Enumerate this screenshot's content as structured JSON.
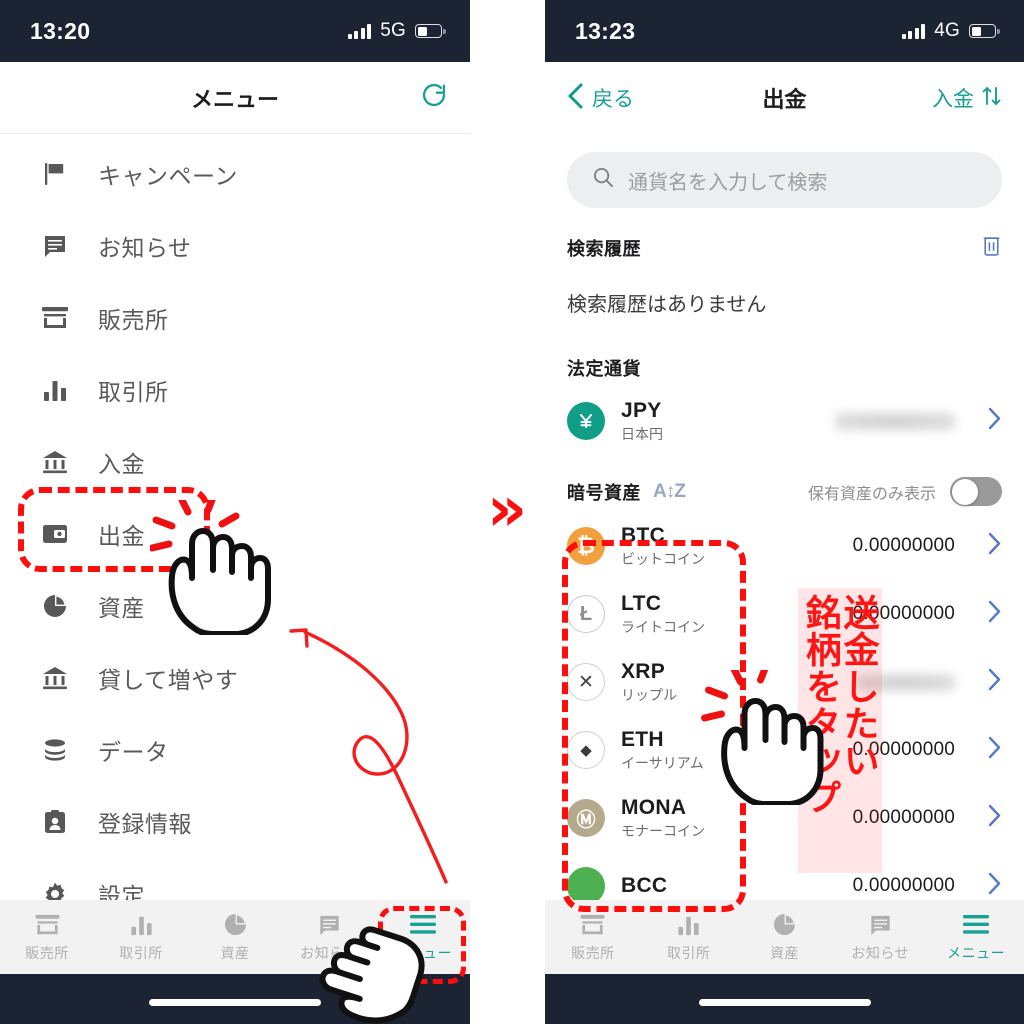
{
  "left_phone": {
    "status_bar": {
      "time": "13:20",
      "network": "5G",
      "signal_icon": "signal-bars-icon",
      "battery_icon": "battery-icon"
    },
    "navbar": {
      "title": "メニュー",
      "refresh_icon": "refresh-icon"
    },
    "menu_items": [
      {
        "label": "キャンペーン",
        "icon": "flag-icon"
      },
      {
        "label": "お知らせ",
        "icon": "message-icon"
      },
      {
        "label": "販売所",
        "icon": "store-icon"
      },
      {
        "label": "取引所",
        "icon": "bar-chart-icon"
      },
      {
        "label": "入金",
        "icon": "bank-icon"
      },
      {
        "label": "出金",
        "icon": "wallet-icon"
      },
      {
        "label": "資産",
        "icon": "pie-chart-icon"
      },
      {
        "label": "貸して増やす",
        "icon": "bank-icon"
      },
      {
        "label": "データ",
        "icon": "database-icon"
      },
      {
        "label": "登録情報",
        "icon": "id-card-icon"
      },
      {
        "label": "設定",
        "icon": "gear-icon"
      }
    ],
    "tabbar": [
      {
        "label": "販売所",
        "icon": "store-icon",
        "active": false
      },
      {
        "label": "取引所",
        "icon": "bar-chart-icon",
        "active": false
      },
      {
        "label": "資産",
        "icon": "pie-chart-icon",
        "active": false
      },
      {
        "label": "お知らせ",
        "icon": "message-icon",
        "active": false
      },
      {
        "label": "メニュー",
        "icon": "hamburger-icon",
        "active": true
      }
    ]
  },
  "right_phone": {
    "status_bar": {
      "time": "13:23",
      "network": "4G",
      "signal_icon": "signal-bars-icon",
      "battery_icon": "battery-icon"
    },
    "navbar": {
      "back_label": "戻る",
      "title": "出金",
      "action_label": "入金",
      "swap_icon": "swap-vertical-icon",
      "back_icon": "chevron-left-icon"
    },
    "search": {
      "placeholder": "通貨名を入力して検索",
      "icon": "search-icon"
    },
    "history": {
      "title": "検索履歴",
      "empty_text": "検索履歴はありません",
      "delete_icon": "trash-icon"
    },
    "fiat": {
      "title": "法定通貨",
      "rows": [
        {
          "symbol": "JPY",
          "name": "日本円",
          "value": "",
          "value_hidden": true,
          "icon": "yen-coin-icon",
          "color": "#109e86",
          "arrow": "chevron-right-icon"
        }
      ]
    },
    "crypto": {
      "title": "暗号資産",
      "sort_icon": "sort-az-icon",
      "toggle_label": "保有資産のみ表示",
      "toggle_on": false,
      "rows": [
        {
          "symbol": "BTC",
          "name": "ビットコイン",
          "value": "0.00000000",
          "value_hidden": false,
          "icon": "bitcoin-icon",
          "color": "#f2a03d",
          "glyph": "₿",
          "arrow": "chevron-right-icon"
        },
        {
          "symbol": "LTC",
          "name": "ライトコイン",
          "value": "0.00000000",
          "value_hidden": false,
          "icon": "litecoin-icon",
          "color": "#ffffff",
          "glyph": "Ł",
          "arrow": "chevron-right-icon"
        },
        {
          "symbol": "XRP",
          "name": "リップル",
          "value": "",
          "value_hidden": true,
          "icon": "ripple-icon",
          "color": "#ffffff",
          "glyph": "✕",
          "arrow": "chevron-right-icon"
        },
        {
          "symbol": "ETH",
          "name": "イーサリアム",
          "value": "0.00000000",
          "value_hidden": false,
          "icon": "ethereum-icon",
          "color": "#ffffff",
          "glyph": "◆",
          "arrow": "chevron-right-icon"
        },
        {
          "symbol": "MONA",
          "name": "モナーコイン",
          "value": "0.00000000",
          "value_hidden": false,
          "icon": "monacoin-icon",
          "color": "#b5a98c",
          "glyph": "M",
          "arrow": "chevron-right-icon"
        },
        {
          "symbol": "BCC",
          "name": "",
          "value": "0.00000000",
          "value_hidden": false,
          "icon": "bitcoincash-icon",
          "color": "#4caf50",
          "glyph": "",
          "arrow": "chevron-right-icon"
        }
      ]
    },
    "tabbar": [
      {
        "label": "販売所",
        "icon": "store-icon",
        "active": false
      },
      {
        "label": "取引所",
        "icon": "bar-chart-icon",
        "active": false
      },
      {
        "label": "資産",
        "icon": "pie-chart-icon",
        "active": false
      },
      {
        "label": "お知らせ",
        "icon": "message-icon",
        "active": false
      },
      {
        "label": "メニュー",
        "icon": "hamburger-icon",
        "active": true
      }
    ]
  },
  "annotations": {
    "flow_chevron": "»",
    "callout_line1": "送金したい",
    "callout_line2": "銘柄をタップ",
    "highlight_color": "#ff0d0d",
    "accent_color": "#17a093"
  }
}
